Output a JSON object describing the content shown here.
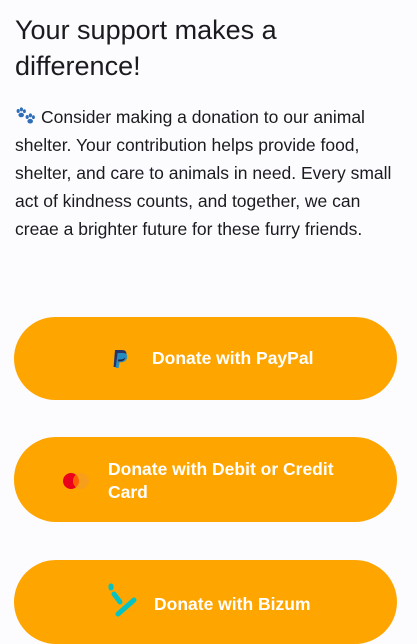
{
  "header": {
    "title": "Your support makes a difference!"
  },
  "intro": {
    "icon": "paw-prints-icon",
    "text": "Consider making a donation to our animal shelter. Your contribution helps provide food, shelter, and care to animals in need. Every small act of kindness counts, and together, we can creae a brighter future for these furry friends."
  },
  "donation_options": {
    "paypal": {
      "label": "Donate with PayPal",
      "icon": "paypal-icon"
    },
    "card": {
      "label": "Donate with Debit or Credit Card",
      "icon": "mastercard-icon"
    },
    "bizum": {
      "label": "Donate with Bizum",
      "icon": "bizum-icon"
    }
  },
  "colors": {
    "accent": "#ffa500",
    "background": "#fcfbfe",
    "text": "#1b1b1f",
    "button_text": "#ffffff"
  }
}
